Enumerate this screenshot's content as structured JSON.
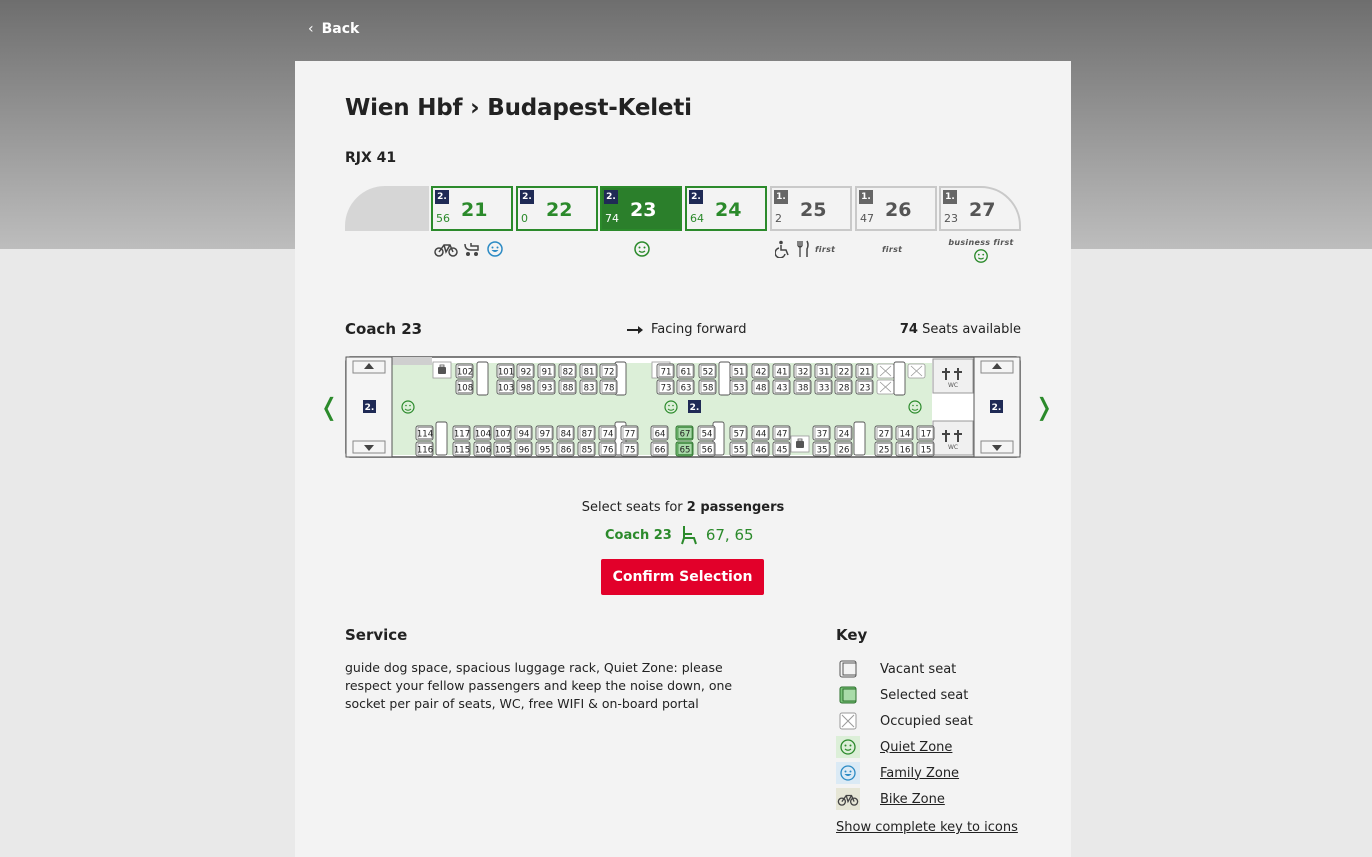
{
  "nav": {
    "back_label": "Back"
  },
  "journey": {
    "route": "Wien Hbf › Budapest-Keleti",
    "train": "RJX 41"
  },
  "coaches": [
    {
      "class": "2.",
      "number": "21",
      "available": "56",
      "state": "default"
    },
    {
      "class": "2.",
      "number": "22",
      "available": "0",
      "state": "default"
    },
    {
      "class": "2.",
      "number": "23",
      "available": "74",
      "state": "selected"
    },
    {
      "class": "2.",
      "number": "24",
      "available": "64",
      "state": "default"
    },
    {
      "class": "1.",
      "number": "25",
      "available": "2",
      "state": "first"
    },
    {
      "class": "1.",
      "number": "26",
      "available": "47",
      "state": "first"
    },
    {
      "class": "1.",
      "number": "27",
      "available": "23",
      "state": "first"
    }
  ],
  "coach_tags": {
    "first": "first",
    "business_first": "business first"
  },
  "coach_view": {
    "title": "Coach 23",
    "facing": "Facing forward",
    "seats_available_count": "74",
    "seats_available_label": "Seats available",
    "class_label": "2.",
    "wc_label": "WC",
    "seat_rows": {
      "top_a": [
        "102",
        "101",
        "92",
        "91",
        "82",
        "81",
        "72",
        "71",
        "61",
        "52",
        "51",
        "42",
        "41",
        "32",
        "31",
        "22",
        "21"
      ],
      "top_b": [
        "108",
        "103",
        "98",
        "93",
        "88",
        "83",
        "78",
        "73",
        "63",
        "58",
        "53",
        "48",
        "43",
        "38",
        "33",
        "28",
        "23"
      ],
      "bottom_a": [
        "114",
        "117",
        "104",
        "107",
        "94",
        "97",
        "84",
        "87",
        "74",
        "77",
        "64",
        "67",
        "54",
        "57",
        "44",
        "47",
        "37",
        "24",
        "27",
        "14",
        "17"
      ],
      "bottom_b": [
        "116",
        "115",
        "106",
        "105",
        "96",
        "95",
        "86",
        "85",
        "76",
        "75",
        "66",
        "65",
        "56",
        "55",
        "46",
        "45",
        "35",
        "26",
        "25",
        "16",
        "15"
      ]
    },
    "selected_seats": [
      "67",
      "65"
    ]
  },
  "selection": {
    "prompt_prefix": "Select seats for",
    "prompt_bold": "2 passengers",
    "coach_label": "Coach 23",
    "seats": "67, 65",
    "confirm_label": "Confirm Selection"
  },
  "service": {
    "title": "Service",
    "text": "guide dog space, spacious luggage rack, Quiet Zone: please respect your fellow passengers and keep the noise down, one socket per pair of seats, WC, free WIFI & on-board portal"
  },
  "key": {
    "title": "Key",
    "items": [
      {
        "label": "Vacant seat",
        "icon": "vacant-seat-icon"
      },
      {
        "label": "Selected seat",
        "icon": "selected-seat-icon"
      },
      {
        "label": "Occupied seat",
        "icon": "occupied-seat-icon"
      },
      {
        "label": "Quiet Zone",
        "icon": "quiet-zone-icon"
      },
      {
        "label": "Family Zone",
        "icon": "family-zone-icon"
      },
      {
        "label": "Bike Zone",
        "icon": "bike-zone-icon"
      }
    ],
    "more_link": "Show complete key to icons"
  },
  "colors": {
    "accent_green": "#2b8a2b",
    "confirm_red": "#e2002a",
    "class2_navy": "#1f2a55"
  }
}
